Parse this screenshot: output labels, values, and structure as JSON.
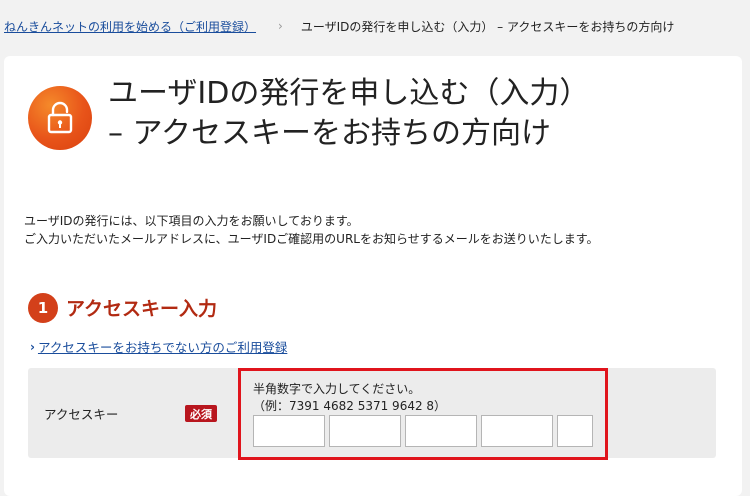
{
  "breadcrumb": {
    "parent_link": "ねんきんネットの利用を始める（ご利用登録）",
    "separator": "›",
    "current": "ユーザIDの発行を申し込む（入力） – アクセスキーをお持ちの方向け"
  },
  "page": {
    "icon": "unlock-icon",
    "title_line1": "ユーザIDの発行を申し込む（入力）",
    "title_line2": "– アクセスキーをお持ちの方向け",
    "intro_line1": "ユーザIDの発行には、以下項目の入力をお願いしております。",
    "intro_line2": "ご入力いただいたメールアドレスに、ユーザIDご確認用のURLをお知らせするメールをお送りいたします。"
  },
  "step": {
    "number": "1",
    "title": "アクセスキー入力"
  },
  "alt_link": {
    "label": "アクセスキーをお持ちでない方のご利用登録"
  },
  "form": {
    "field_label": "アクセスキー",
    "required_label": "必須",
    "hint_line1": "半角数字で入力してください。",
    "hint_line2": "（例：7391 4682 5371 9642 8）",
    "inputs": [
      {
        "value": ""
      },
      {
        "value": ""
      },
      {
        "value": ""
      },
      {
        "value": ""
      },
      {
        "value": ""
      }
    ]
  },
  "colors": {
    "accent_orange": "#e8541a",
    "step_red": "#d3401a",
    "required_red": "#b8161e",
    "highlight_border": "#e0141c",
    "link_blue": "#1a4d9c"
  }
}
